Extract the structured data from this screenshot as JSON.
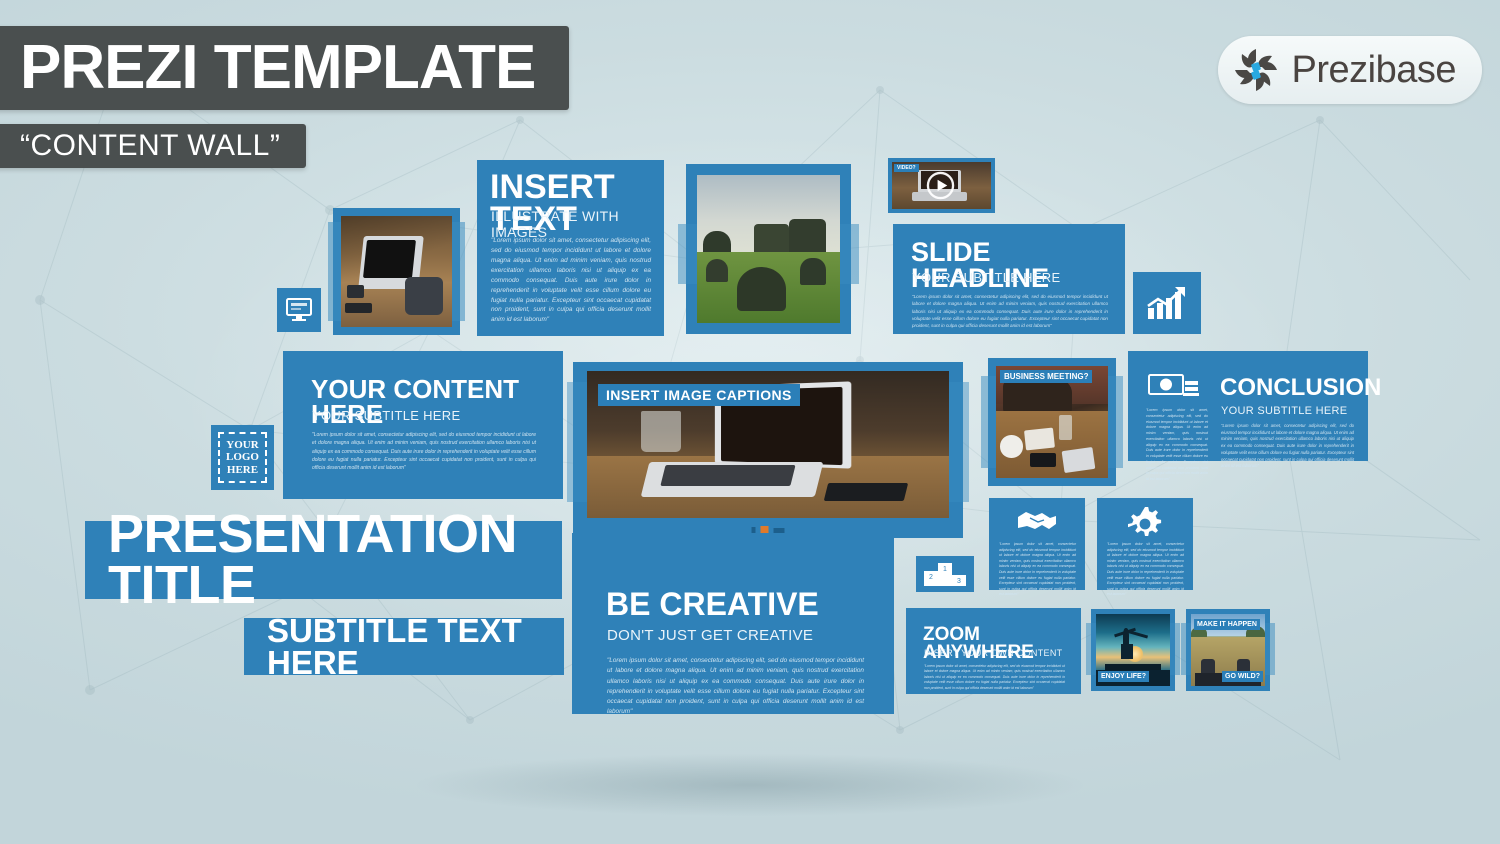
{
  "header": {
    "title": "PREZI TEMPLATE",
    "subtitle": "“CONTENT WALL”"
  },
  "logo": {
    "brand_prefix": "Prezi",
    "brand_suffix": "base",
    "icon": "prezibase-pinwheel-icon"
  },
  "colors": {
    "accent_blue": "#2f81b8",
    "banner_dark": "#4a4f4f",
    "background": "#ccdde1",
    "logo_blue": "#29a9e0"
  },
  "lorem": {
    "full": "\"Lorem ipsum dolor sit amet, consectetur adipiscing elit, sed do eiusmod tempor incididunt ut labore et dolore magna aliqua. Ut enim ad minim veniam, quis nostrud exercitation ullamco laboris nisi ut aliquip ex ea commodo consequat. Duis aute irure dolor in reprehenderit in voluptate velit esse cillum dolore eu fugiat nulla pariatur. Excepteur sint occaecat cupidatat non proident, sunt in culpa qui officia deserunt mollit anim id est laborum\""
  },
  "panels": {
    "insert_text": {
      "title": "INSERT TEXT",
      "subtitle": "ILLUSTRATE WITH IMAGES"
    },
    "slide_headline": {
      "title": "SLIDE HEADLINE",
      "subtitle": "YOUR SUBTITLE HERE"
    },
    "your_content": {
      "title": "YOUR CONTENT HERE",
      "subtitle": "YOUR SUBTITLE HERE"
    },
    "conclusion": {
      "title": "CONCLUSION",
      "subtitle": "YOUR SUBTITLE HERE",
      "icon": "money-cash-icon"
    },
    "be_creative": {
      "title": "BE CREATIVE",
      "subtitle": "DON'T JUST GET CREATIVE"
    },
    "zoom_anywhere": {
      "title": "ZOOM ANYWHERE",
      "subtitle": "INSERT YOUR OWN CONTENT"
    },
    "presentation_title": {
      "title": "PRESENTATION TITLE"
    },
    "subtitle_text": {
      "title": "SUBTITLE TEXT HERE"
    }
  },
  "logo_placeholder": {
    "line1": "YOUR",
    "line2": "LOGO",
    "line3": "HERE"
  },
  "captions": {
    "image_captions": "INSERT IMAGE CAPTIONS",
    "business_meeting": "BUSINESS MEETING?",
    "video": "VIDEO?",
    "enjoy_life": "ENJOY LIFE?",
    "make_it_happen": "MAKE IT HAPPEN",
    "go_wild": "GO WILD?"
  },
  "icons": {
    "monitor": "desktop-monitor-icon",
    "growth_chart": "growth-chart-icon",
    "handshake": "handshake-icon",
    "gear": "gear-icon",
    "podium": "podium-ranking-icon",
    "play": "play-button-icon"
  },
  "podium": {
    "first": "1",
    "second": "2",
    "third": "3"
  }
}
